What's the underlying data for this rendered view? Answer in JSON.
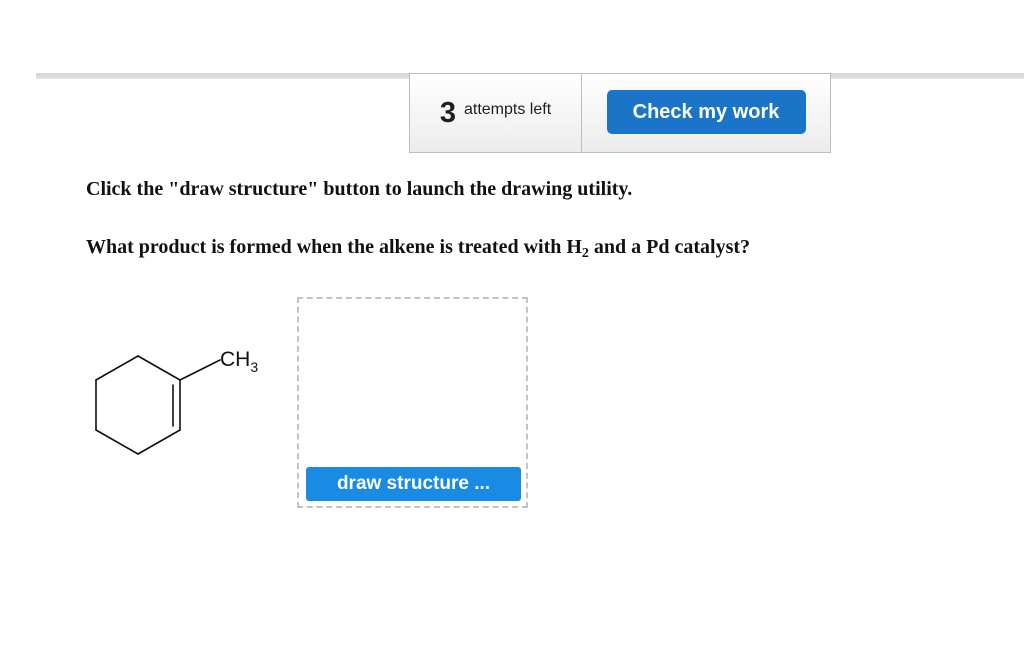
{
  "toolbar": {
    "attempts_count": "3",
    "attempts_label": "attempts left",
    "check_label": "Check my work"
  },
  "instruction": "Click the \"draw structure\" button to launch the drawing utility.",
  "question": {
    "before": "What product is formed when the alkene is treated with H",
    "subscript": "2",
    "after": " and a Pd catalyst?"
  },
  "molecule": {
    "substituent": "CH",
    "substituent_subscript": "3"
  },
  "draw_button_label": "draw structure ..."
}
